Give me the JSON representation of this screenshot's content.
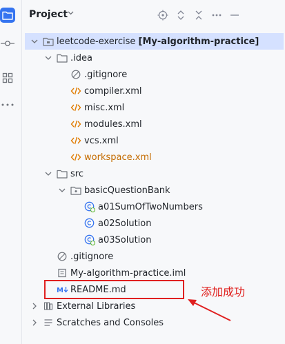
{
  "panel": {
    "title": "Project"
  },
  "tree": {
    "root_name": "leetcode-exercise",
    "root_module": "[My-algorithm-practice]",
    "idea": ".idea",
    "idea_gitignore": ".gitignore",
    "compiler": "compiler.xml",
    "misc": "misc.xml",
    "modules": "modules.xml",
    "vcs": "vcs.xml",
    "workspace": "workspace.xml",
    "src": "src",
    "package": "basicQuestionBank",
    "class1": "a01SumOfTwoNumbers",
    "class2": "a02Solution",
    "class3": "a03Solution",
    "gitignore": ".gitignore",
    "iml": "My-algorithm-practice.iml",
    "readme": "README.md",
    "ext_libs": "External Libraries",
    "scratches": "Scratches and Consoles"
  },
  "annotation": {
    "text": "添加成功"
  },
  "colors": {
    "accent": "#3574f0",
    "selection": "#d5e1ff",
    "annotation": "#e02020",
    "xml": "#e07b00"
  },
  "icons": [
    "project-icon",
    "commit-icon",
    "structure-icon",
    "more-icon",
    "locate-icon",
    "expand-collapse-icon",
    "collapse-all-icon",
    "options-icon",
    "minimize-icon",
    "folder-icon",
    "xml-icon",
    "gitignore-icon",
    "package-icon",
    "class-icon",
    "iml-icon",
    "markdown-icon",
    "library-icon",
    "scratches-icon"
  ]
}
